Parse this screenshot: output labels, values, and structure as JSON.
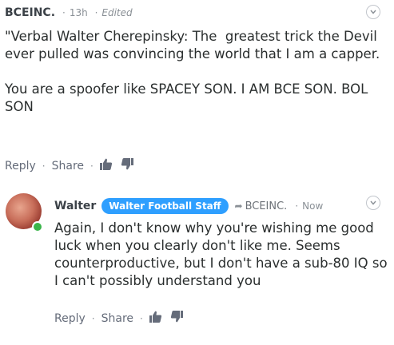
{
  "comments": [
    {
      "author": "BCEINC.",
      "time": "13h",
      "edited_label": "Edited",
      "text": "\"Verbal Walter Cherepinsky: The  greatest trick the Devil ever pulled was convincing the world that I am a capper.\n\nYou are a spoofer like SPACEY SON. I AM BCE SON. BOL SON",
      "actions": {
        "reply": "Reply",
        "share": "Share"
      }
    },
    {
      "author": "Walter",
      "badge": "Walter Football Staff",
      "reply_to": "BCEINC.",
      "time": "Now",
      "text": "Again, I don't know why you're wishing me good luck when you clearly don't like me. Seems counterproductive, but I don't have a sub-80 IQ so I can't possibly understand you",
      "actions": {
        "reply": "Reply",
        "share": "Share"
      }
    }
  ],
  "icons": {
    "upvote": "thumbs-up-icon",
    "downvote": "thumbs-down-icon",
    "menu": "chevron-down-icon",
    "reply_arrow": "reply-arrow-icon"
  },
  "colors": {
    "badge": "#2e9fff",
    "online": "#3ab54a"
  }
}
